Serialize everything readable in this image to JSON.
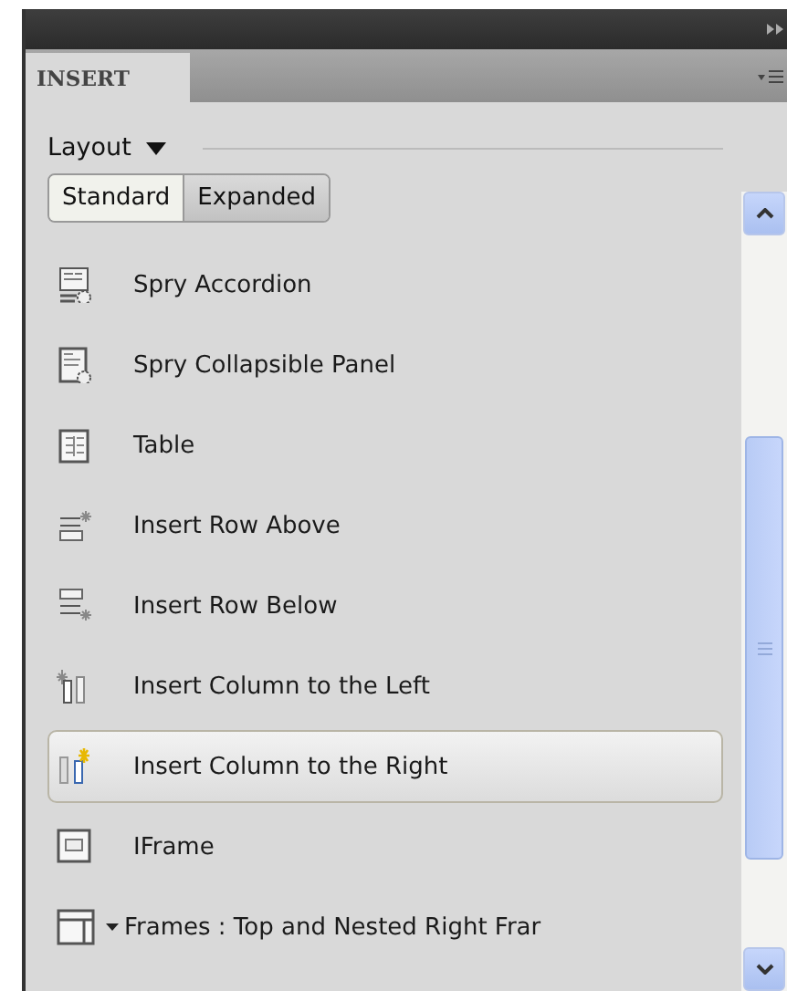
{
  "panel": {
    "tab": "INSERT"
  },
  "category": {
    "label": "Layout"
  },
  "modes": [
    {
      "label": "Standard",
      "selected": true
    },
    {
      "label": "Expanded",
      "selected": false
    }
  ],
  "items": [
    {
      "label": "Spry Accordion",
      "kind": "accordion",
      "selected": false
    },
    {
      "label": "Spry Collapsible Panel",
      "kind": "collapsible",
      "selected": false
    },
    {
      "label": "Table",
      "kind": "table",
      "selected": false
    },
    {
      "label": "Insert Row Above",
      "kind": "row-above",
      "selected": false
    },
    {
      "label": "Insert Row Below",
      "kind": "row-below",
      "selected": false
    },
    {
      "label": "Insert Column to the Left",
      "kind": "col-left",
      "selected": false
    },
    {
      "label": "Insert Column to the Right",
      "kind": "col-right",
      "selected": true
    },
    {
      "label": "IFrame",
      "kind": "iframe",
      "selected": false
    },
    {
      "label": "Frames : Top and Nested Right Frar",
      "kind": "frames",
      "selected": false,
      "dropdown": true
    }
  ]
}
